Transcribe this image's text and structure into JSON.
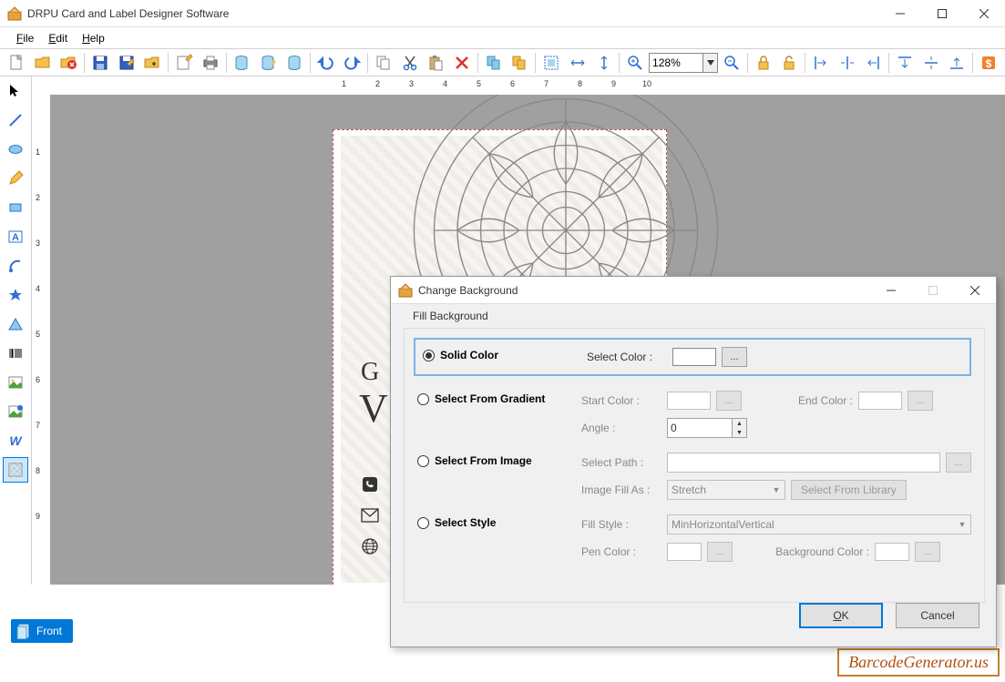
{
  "title": "DRPU Card and Label Designer Software",
  "menu": {
    "file": "File",
    "edit": "Edit",
    "help": "Help"
  },
  "zoom": "128%",
  "ruler_h": [
    "1",
    "2",
    "3",
    "4",
    "5",
    "6",
    "7",
    "8",
    "9",
    "10"
  ],
  "ruler_v": [
    "1",
    "2",
    "3",
    "4",
    "5",
    "6",
    "7",
    "8",
    "9"
  ],
  "tab_front": "Front",
  "watermark": "BarcodeGenerator.us",
  "dialog": {
    "title": "Change Background",
    "section": "Fill Background",
    "opt_solid": "Solid Color",
    "opt_gradient": "Select From Gradient",
    "opt_image": "Select From Image",
    "opt_style": "Select Style",
    "select_color": "Select Color :",
    "start_color": "Start Color :",
    "end_color": "End Color :",
    "angle": "Angle :",
    "angle_val": "0",
    "select_path": "Select Path :",
    "image_fill_as": "Image Fill As :",
    "image_fill_val": "Stretch",
    "lib_btn": "Select From Library",
    "fill_style": "Fill Style :",
    "fill_style_val": "MinHorizontalVertical",
    "pen_color": "Pen Color :",
    "bg_color": "Background Color :",
    "browse": "...",
    "ok": "OK",
    "cancel": "Cancel"
  }
}
